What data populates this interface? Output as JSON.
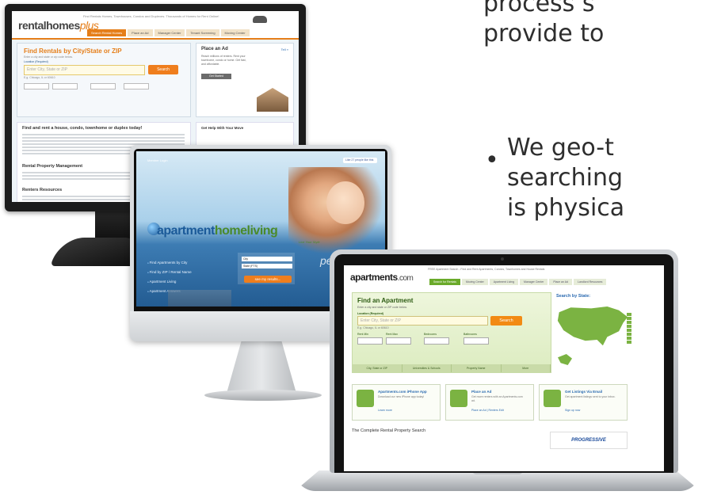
{
  "slide": {
    "line1": "process s",
    "line2": "provide to",
    "bullet": "•",
    "b2_line1": "We geo-t",
    "b2_line2": "searching",
    "b2_line3": "is physica"
  },
  "rentalhomes": {
    "logo_main": "rentalhomes",
    "logo_plus": "plus",
    "tagline": "Find Rentals Homes, Townhouses, Condos and Duplexes. Thousands of Homes for Rent Online!",
    "nav": [
      "Search Rental Homes",
      "Place an Ad",
      "Manager Center",
      "Tenant Screening",
      "Moving Center"
    ],
    "search_title": "Find Rentals by City/State or ZIP",
    "search_sub": "Enter a city and state or zip code below.",
    "location_label": "Location (Required)",
    "search_placeholder": "Enter City, State or ZIP",
    "search_button": "Search",
    "example": "E.g. Chicago, IL or 60610",
    "ad_title": "Place an Ad",
    "ad_link": "Tell »",
    "ad_text": "Reach millions of renters. Rent your townhome, condo or home. Get fast, and affordable.",
    "ad_button": "Get Started",
    "body_title": "Find and rent a house, condo, townhome or duplex today!",
    "body_title2": "Rental Property Management",
    "body_title3": "Renters Resources",
    "side_title": "Get Help With Your Move"
  },
  "ahl": {
    "logo_main": "apartment",
    "logo_green": "homeliving",
    "tagline": "Live Your Style",
    "toplinks": "Member Login",
    "fb": "Like 27 people like this",
    "menu": [
      "Find Apartments by City",
      "Find by ZIP / Rental Name",
      "Apartment Living",
      "Apartment Answers"
    ],
    "select_city": "City",
    "select_state": "State (FTS)",
    "go_button": "see my results...",
    "perf": "perf"
  },
  "apartments": {
    "logo_main": "apartments",
    "logo_dotcom": ".com",
    "tagline": "FREE Apartment Search - Find and Rent Apartments, Condos, Townhomes and House Rentals",
    "nav": [
      "Search for Rentals",
      "Moving Center",
      "Apartment Living",
      "Manager Center",
      "Place an Ad",
      "Landlord Resources"
    ],
    "search_title": "Find an Apartment",
    "search_sub": "Enter a city and state or ZIP code below.",
    "location_label": "Location (Required)",
    "search_placeholder": "Enter City, State or ZIP",
    "search_button": "Search",
    "example": "E.g. Chicago, IL or 60610",
    "filters": [
      "Rent Min",
      "Rent Max",
      "Bedrooms",
      "Bathrooms"
    ],
    "tabs": [
      "City, State or ZIP",
      "Universities & Schools",
      "Property Name",
      "More"
    ],
    "map_title": "Search by State:",
    "cards": [
      {
        "title": "Apartments.com iPhone App",
        "desc": "Download our new iPhone app today!",
        "link": "Learn more"
      },
      {
        "title": "Place an Ad",
        "desc": "Get more renters with an Apartments.com ad.",
        "link": "Place an Ad | Renters Edit"
      },
      {
        "title": "Get Listings Via Email",
        "desc": "Get apartment listings sent to your inbox.",
        "link": "Sign up now"
      }
    ],
    "bottom_title": "The Complete Rental Property Search",
    "sponsor": "PROGRESSIVE"
  }
}
